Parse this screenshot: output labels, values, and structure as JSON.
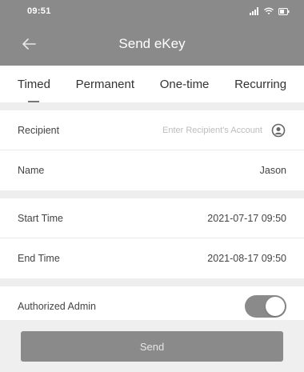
{
  "status_bar": {
    "time": "09:51"
  },
  "header": {
    "title": "Send eKey"
  },
  "tabs": [
    {
      "label": "Timed",
      "active": true
    },
    {
      "label": "Permanent",
      "active": false
    },
    {
      "label": "One-time",
      "active": false
    },
    {
      "label": "Recurring",
      "active": false
    }
  ],
  "recipient": {
    "label": "Recipient",
    "placeholder": "Enter Recipient's Account",
    "value": ""
  },
  "name": {
    "label": "Name",
    "value": "Jason"
  },
  "start_time": {
    "label": "Start Time",
    "value": "2021-07-17 09:50"
  },
  "end_time": {
    "label": "End Time",
    "value": "2021-08-17 09:50"
  },
  "authorized_admin": {
    "label": "Authorized Admin",
    "enabled": true
  },
  "send_label": "Send",
  "colors": {
    "header_bg": "#8a8a8a",
    "toggle_on": "#8a8a8a",
    "button_bg": "#8a8a8a"
  }
}
